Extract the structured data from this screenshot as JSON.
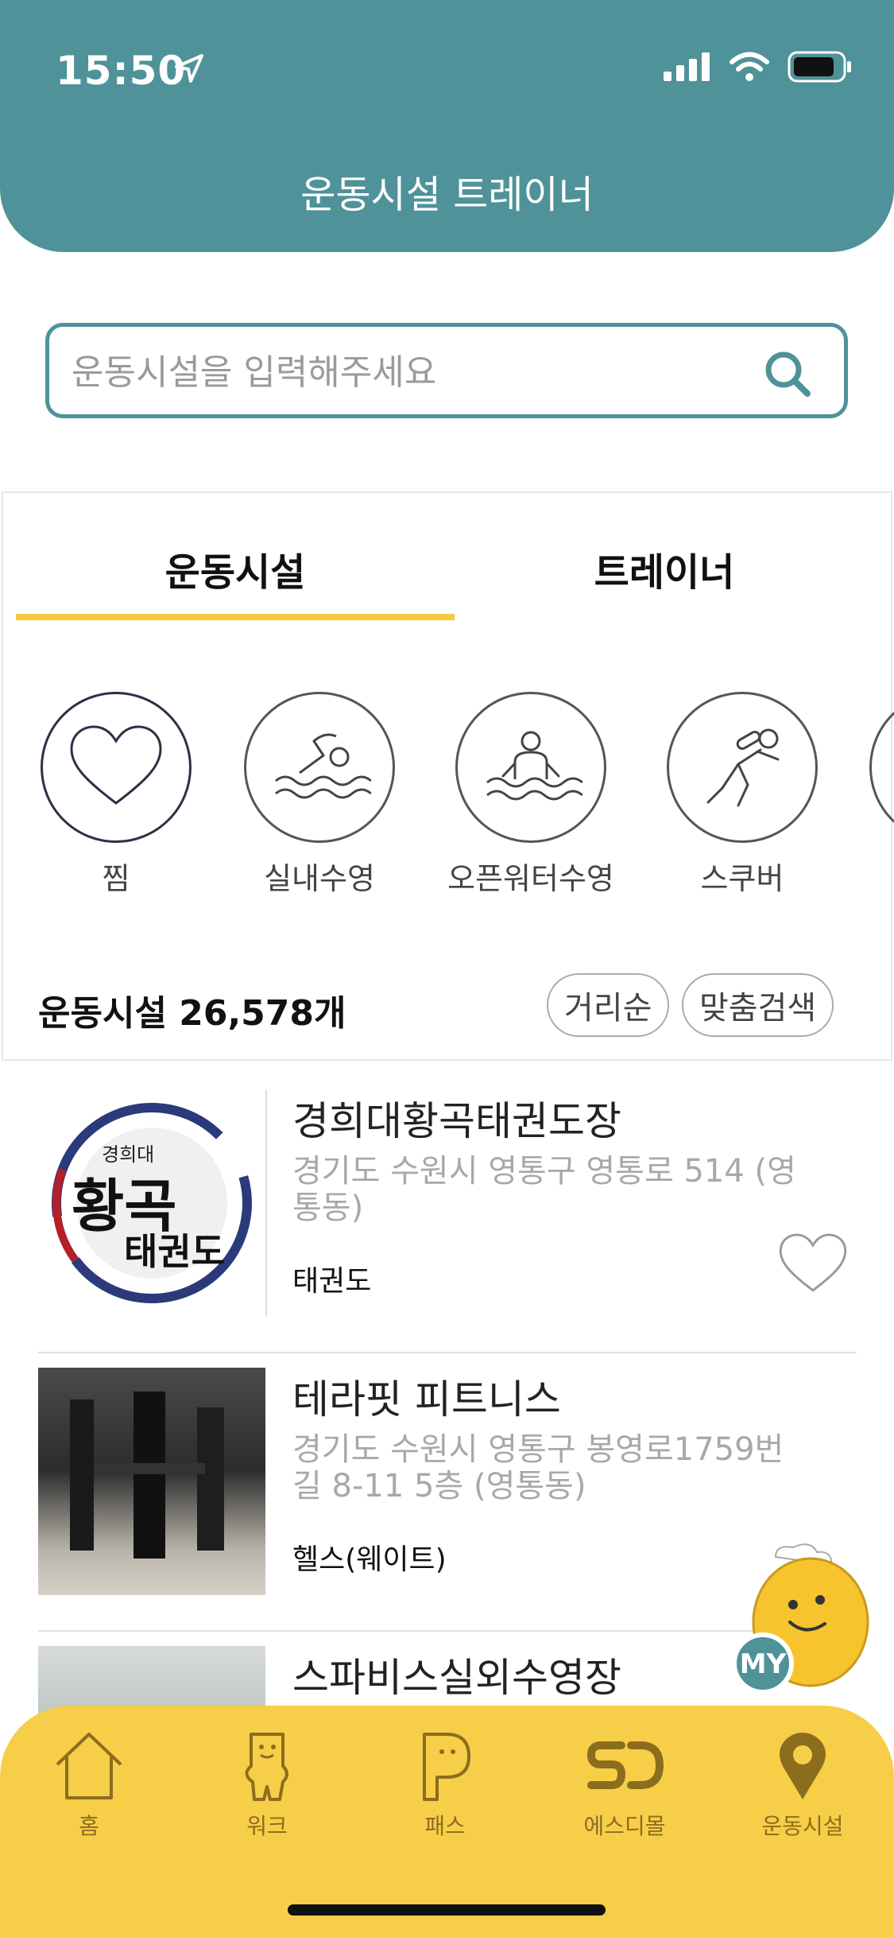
{
  "status": {
    "time": "15:50"
  },
  "header": {
    "title": "운동시설 트레이너"
  },
  "search": {
    "placeholder": "운동시설을 입력해주세요"
  },
  "tabs": [
    {
      "label": "운동시설",
      "active": true
    },
    {
      "label": "트레이너",
      "active": false
    }
  ],
  "categories": [
    {
      "label": "찜",
      "icon": "heart-icon"
    },
    {
      "label": "실내수영",
      "icon": "swimming-icon"
    },
    {
      "label": "오픈워터수영",
      "icon": "open-water-icon"
    },
    {
      "label": "스쿠버",
      "icon": "scuba-icon"
    }
  ],
  "summary": {
    "count_text": "운동시설 26,578개"
  },
  "sort": {
    "distance": "거리순",
    "custom": "맞춤검색"
  },
  "facilities": [
    {
      "name": "경희대황곡태권도장",
      "address": "경기도 수원시 영통구 영통로 514 (영통동)",
      "category": "태권도",
      "logo_text_top": "경희대",
      "logo_text_main": "황곡",
      "logo_text_sub": "태권도"
    },
    {
      "name": "테라핏 피트니스",
      "address": "경기도 수원시 영통구 봉영로1759번길 8-11 5층 (영통동)",
      "category": "헬스(웨이트)"
    },
    {
      "name": "스파비스실외수영장",
      "address": "",
      "category": ""
    }
  ],
  "mascot": {
    "badge": "MY"
  },
  "nav": [
    {
      "label": "홈",
      "icon": "home-icon"
    },
    {
      "label": "워크",
      "icon": "walk-character-icon"
    },
    {
      "label": "패스",
      "icon": "pass-p-icon"
    },
    {
      "label": "에스디몰",
      "icon": "sd-mall-icon"
    },
    {
      "label": "운동시설",
      "icon": "location-pin-icon",
      "active": true
    }
  ],
  "colors": {
    "header": "#4f9299",
    "accent": "#f5c842",
    "nav": "#f7ce47"
  }
}
